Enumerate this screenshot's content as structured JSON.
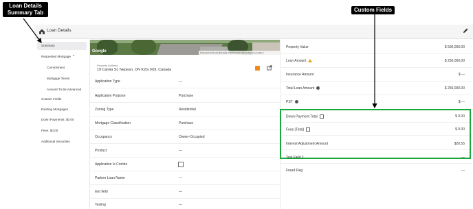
{
  "annotations": {
    "loan_details_callout": [
      "Loan Details",
      "Summary Tab"
    ],
    "custom_fields_callout": "Custom Fields"
  },
  "header": {
    "title": "Loan Details",
    "icon": "house-icon",
    "edit_icon": "pencil-icon"
  },
  "sidebar": {
    "items": [
      {
        "label": "Summary",
        "active": true
      },
      {
        "label": "Requested Mortgage",
        "expandable": true
      },
      {
        "label": "Commitment",
        "sub": true
      },
      {
        "label": "Mortgage Terms",
        "sub": true
      },
      {
        "label": "Amount To Be Advanced",
        "sub": true
      },
      {
        "label": "Custom Fields"
      },
      {
        "label": "Existing Mortgages"
      },
      {
        "label": "Down Payments: $0.00"
      },
      {
        "label": "Fees: $0.00"
      },
      {
        "label": "Additional Securities"
      }
    ]
  },
  "map": {
    "logo": "Google",
    "credits": "Keyboard shortcuts   Map data ©2023 Google   Terms   Report a problem"
  },
  "property": {
    "address_label": "Property Address",
    "address": "19 Carola St, Nepean, ON K2G 0X9, Canada"
  },
  "application_rows": [
    {
      "label": "Application Type",
      "value": "—"
    },
    {
      "label": "Application Purpose",
      "value": "Purchase"
    },
    {
      "label": "Zoning Type",
      "value": "Residential"
    },
    {
      "label": "Mortgage Classification",
      "value": "Purchase"
    },
    {
      "label": "Occupancy",
      "value": "Owner-Occupied"
    },
    {
      "label": "Product",
      "value": "—"
    },
    {
      "label": "Application Is Combo",
      "value": "",
      "checkbox": true
    },
    {
      "label": "Partner Loan Name",
      "value": "—"
    },
    {
      "label": "test field",
      "value": "—"
    },
    {
      "label": "Testing",
      "value": "—"
    }
  ],
  "summary_rows": [
    {
      "label": "Property Value",
      "value": "$ 500,000.00"
    },
    {
      "label": "Loan Amount",
      "value": "$ 250,000.00",
      "icon": "warning-icon"
    },
    {
      "label": "Insurance Amount",
      "value": "$ —"
    },
    {
      "label": "Total Loan Amount",
      "value": "$ 250,000.00",
      "icon": "info-icon"
    },
    {
      "label": "PST",
      "value": "$ —",
      "icon": "info-icon"
    }
  ],
  "custom_fields": [
    {
      "label": "Down Payment Total",
      "value": "$ 0.00",
      "icon": "external-link-icon"
    },
    {
      "label": "Fees (Total)",
      "value": "$ 0.00",
      "icon": "external-link-icon"
    },
    {
      "label": "Interest Adjustment Amount",
      "value": "$20.55"
    },
    {
      "label": "Test Field 2",
      "value": "—"
    },
    {
      "label": "Fraud Flag",
      "value": "—"
    }
  ],
  "colors": {
    "highlight_box": "#19a83a",
    "orange_action": "#f08a1c"
  }
}
